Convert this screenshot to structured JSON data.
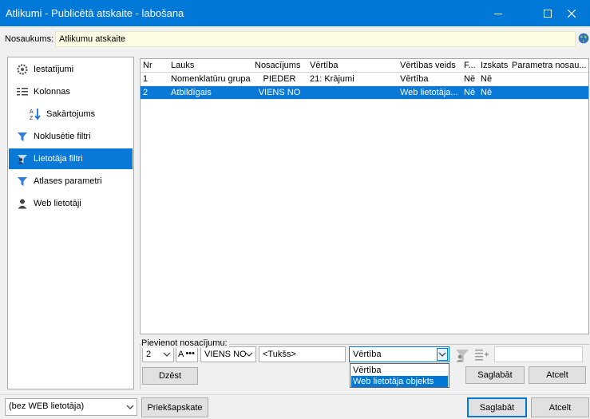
{
  "window": {
    "title": "Atlikumi - Publicētā atskaite - labošana"
  },
  "name_bar": {
    "label": "Nosaukums:",
    "value": "Atlikumu atskaite"
  },
  "sidebar": {
    "items": [
      {
        "label": "Iestatījumi",
        "icon": "gear-icon"
      },
      {
        "label": "Kolonnas",
        "icon": "columns-icon"
      },
      {
        "label": "Sakārtojums",
        "icon": "sort-az-icon"
      },
      {
        "label": "Noklusētie filtri",
        "icon": "filter-icon"
      },
      {
        "label": "Lietotāja filtri",
        "icon": "user-filter-icon",
        "selected": true
      },
      {
        "label": "Atlases parametri",
        "icon": "filter-icon"
      },
      {
        "label": "Web lietotāji",
        "icon": "user-icon"
      }
    ]
  },
  "grid": {
    "columns": [
      "Nr",
      "Lauks",
      "Nosacījums",
      "Vērtība",
      "Vērtības veids",
      "F...",
      "Izskats",
      "Parametra nosau..."
    ],
    "rows": [
      [
        "1",
        "Nomenklatūru grupa",
        "PIEDER",
        "21: Krājumi",
        "Vērtība",
        "Nē",
        "Nē",
        ""
      ],
      [
        "2",
        "Atbildīgais",
        "VIENS NO",
        "",
        "Web lietotāja...",
        "Nē",
        "Nē",
        ""
      ]
    ],
    "selected_row": 1
  },
  "add_condition": {
    "legend": "Pievienot nosacījumu:",
    "nr_value": "2",
    "field_value": "A",
    "more_label": "•••",
    "condition_value": "VIENS NO",
    "value_text": "<Tukšs>",
    "value_type_selected": "Vērtība",
    "value_type_options": [
      "Vērtība",
      "Web lietotāja objekts"
    ],
    "highlighted_option": 1,
    "delete_label": "Dzēst",
    "save_label": "Saglabāt",
    "cancel_label": "Atcelt"
  },
  "bottom": {
    "web_user_value": "(bez WEB lietotāja)",
    "preview_label": "Priekšapskate",
    "save_label": "Saglabāt",
    "cancel_label": "Atcelt"
  },
  "colors": {
    "title_bar": "#0078d7",
    "selection": "#0a78d7",
    "name_field_bg": "#fdfde3"
  }
}
